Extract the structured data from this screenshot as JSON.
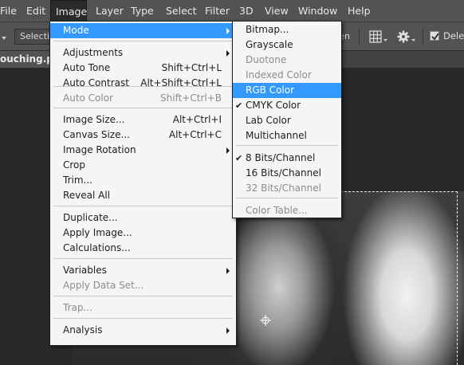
{
  "menubar": {
    "items": [
      "File",
      "Edit",
      "Image",
      "Layer",
      "Type",
      "Select",
      "Filter",
      "3D",
      "View",
      "Window",
      "Help"
    ]
  },
  "options": {
    "selection_label": "Selectio",
    "partial_button": "en",
    "delete_label": "Delete"
  },
  "document": {
    "tab_label": "ouching.psd"
  },
  "image_menu": {
    "items": [
      {
        "label": "Mode",
        "shortcut": "",
        "submenu": true,
        "disabled": false
      },
      {
        "label": "Adjustments",
        "shortcut": "",
        "submenu": true,
        "disabled": false
      },
      {
        "label": "Auto Tone",
        "shortcut": "Shift+Ctrl+L",
        "submenu": false,
        "disabled": false
      },
      {
        "label": "Auto Contrast",
        "shortcut": "Alt+Shift+Ctrl+L",
        "submenu": false,
        "disabled": false
      },
      {
        "label": "Auto Color",
        "shortcut": "Shift+Ctrl+B",
        "submenu": false,
        "disabled": true
      },
      {
        "label": "Image Size...",
        "shortcut": "Alt+Ctrl+I",
        "submenu": false,
        "disabled": false
      },
      {
        "label": "Canvas Size...",
        "shortcut": "Alt+Ctrl+C",
        "submenu": false,
        "disabled": false
      },
      {
        "label": "Image Rotation",
        "shortcut": "",
        "submenu": true,
        "disabled": false
      },
      {
        "label": "Crop",
        "shortcut": "",
        "submenu": false,
        "disabled": false
      },
      {
        "label": "Trim...",
        "shortcut": "",
        "submenu": false,
        "disabled": false
      },
      {
        "label": "Reveal All",
        "shortcut": "",
        "submenu": false,
        "disabled": false
      },
      {
        "label": "Duplicate...",
        "shortcut": "",
        "submenu": false,
        "disabled": false
      },
      {
        "label": "Apply Image...",
        "shortcut": "",
        "submenu": false,
        "disabled": false
      },
      {
        "label": "Calculations...",
        "shortcut": "",
        "submenu": false,
        "disabled": false
      },
      {
        "label": "Variables",
        "shortcut": "",
        "submenu": true,
        "disabled": false
      },
      {
        "label": "Apply Data Set...",
        "shortcut": "",
        "submenu": false,
        "disabled": true
      },
      {
        "label": "Trap...",
        "shortcut": "",
        "submenu": false,
        "disabled": true
      },
      {
        "label": "Analysis",
        "shortcut": "",
        "submenu": true,
        "disabled": false
      }
    ]
  },
  "mode_menu": {
    "items": [
      {
        "label": "Bitmap...",
        "checked": false,
        "disabled": false
      },
      {
        "label": "Grayscale",
        "checked": false,
        "disabled": false
      },
      {
        "label": "Duotone",
        "checked": false,
        "disabled": true
      },
      {
        "label": "Indexed Color",
        "checked": false,
        "disabled": true
      },
      {
        "label": "RGB Color",
        "checked": false,
        "disabled": false
      },
      {
        "label": "CMYK Color",
        "checked": true,
        "disabled": false
      },
      {
        "label": "Lab Color",
        "checked": false,
        "disabled": false
      },
      {
        "label": "Multichannel",
        "checked": false,
        "disabled": false
      },
      {
        "label": "8 Bits/Channel",
        "checked": true,
        "disabled": false
      },
      {
        "label": "16 Bits/Channel",
        "checked": false,
        "disabled": false
      },
      {
        "label": "32 Bits/Channel",
        "checked": false,
        "disabled": true
      },
      {
        "label": "Color Table...",
        "checked": false,
        "disabled": true
      }
    ],
    "highlighted": "RGB Color"
  },
  "colors": {
    "highlight": "#3399ff",
    "menu_bg": "#f5f5f5",
    "chrome": "#535353"
  }
}
